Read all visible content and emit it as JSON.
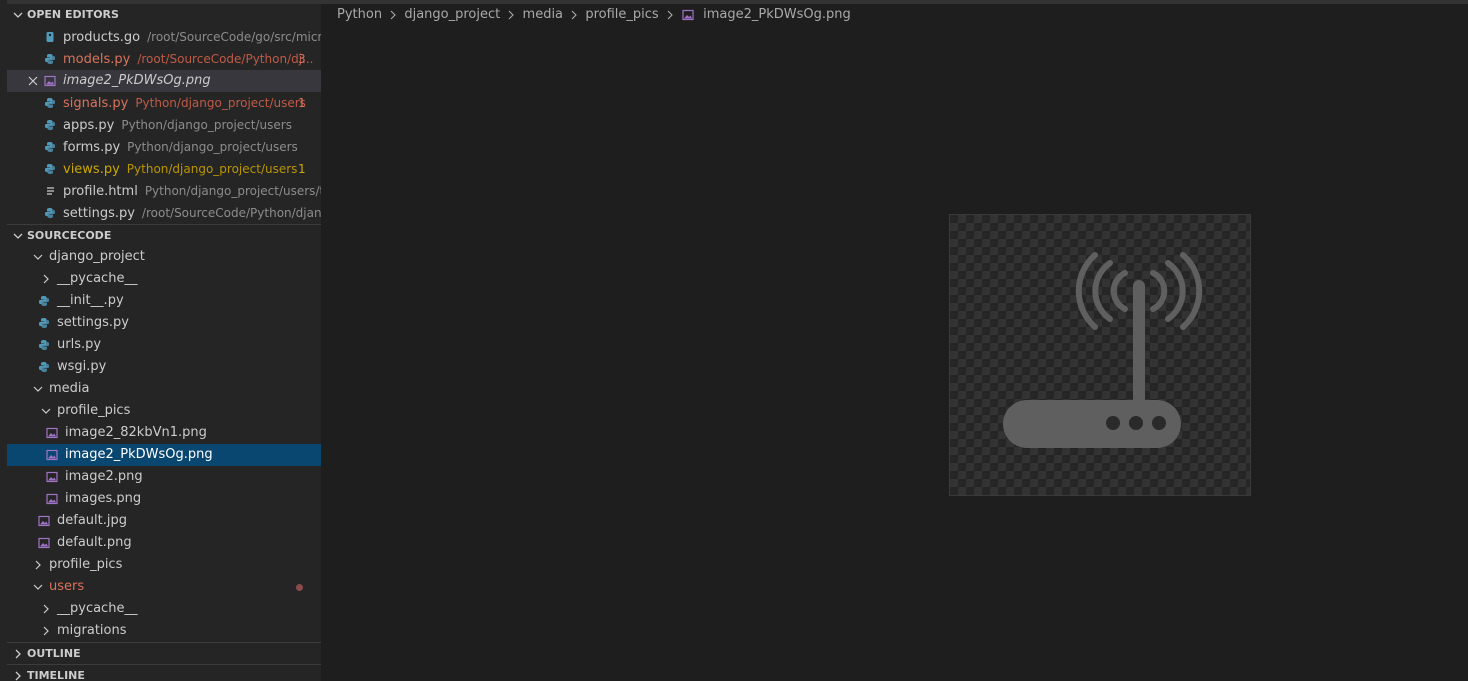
{
  "colors": {
    "sidebar_bg": "#252526",
    "editor_bg": "#1e1e1e",
    "selection": "#094771",
    "modified": "#d9735b",
    "warning": "#cca700",
    "python_icon": "#519aba",
    "image_icon": "#a074c4"
  },
  "open_editors": {
    "title": "OPEN EDITORS",
    "items": [
      {
        "name": "products.go",
        "path": "/root/SourceCode/go/src/micros...",
        "badge": "",
        "icon": "go-file-icon"
      },
      {
        "name": "models.py",
        "path": "/root/SourceCode/Python/dj...",
        "badge": "3",
        "icon": "python-file-icon"
      },
      {
        "name": "image2_PkDWsOg.png",
        "path": "",
        "badge": "",
        "icon": "image-file-icon"
      },
      {
        "name": "signals.py",
        "path": "Python/django_project/users",
        "badge": "1",
        "icon": "python-file-icon"
      },
      {
        "name": "apps.py",
        "path": "Python/django_project/users",
        "badge": "",
        "icon": "python-file-icon"
      },
      {
        "name": "forms.py",
        "path": "Python/django_project/users",
        "badge": "",
        "icon": "python-file-icon"
      },
      {
        "name": "views.py",
        "path": "Python/django_project/users",
        "badge": "1",
        "icon": "python-file-icon"
      },
      {
        "name": "profile.html",
        "path": "Python/django_project/users/te...",
        "badge": "",
        "icon": "html-file-icon"
      },
      {
        "name": "settings.py",
        "path": "/root/SourceCode/Python/djang...",
        "badge": "",
        "icon": "python-file-icon"
      }
    ]
  },
  "explorer": {
    "title": "SOURCECODE",
    "items": [
      {
        "name": "django_project",
        "type": "folder-open"
      },
      {
        "name": "__pycache__",
        "type": "folder-closed"
      },
      {
        "name": "__init__.py",
        "type": "python"
      },
      {
        "name": "settings.py",
        "type": "python"
      },
      {
        "name": "urls.py",
        "type": "python"
      },
      {
        "name": "wsgi.py",
        "type": "python"
      },
      {
        "name": "media",
        "type": "folder-open"
      },
      {
        "name": "profile_pics",
        "type": "folder-open"
      },
      {
        "name": "image2_82kbVn1.png",
        "type": "image"
      },
      {
        "name": "image2_PkDWsOg.png",
        "type": "image"
      },
      {
        "name": "image2.png",
        "type": "image"
      },
      {
        "name": "images.png",
        "type": "image"
      },
      {
        "name": "default.jpg",
        "type": "image"
      },
      {
        "name": "default.png",
        "type": "image"
      },
      {
        "name": "profile_pics",
        "type": "folder-closed"
      },
      {
        "name": "users",
        "type": "folder-open"
      },
      {
        "name": "__pycache__",
        "type": "folder-closed"
      },
      {
        "name": "migrations",
        "type": "folder-closed"
      }
    ]
  },
  "outline": {
    "title": "OUTLINE"
  },
  "timeline": {
    "title": "TIMELINE"
  },
  "breadcrumb": {
    "items": [
      "Python",
      "django_project",
      "media",
      "profile_pics"
    ],
    "file": "image2_PkDWsOg.png"
  },
  "preview": {
    "image_subject": "wifi-router-icon"
  }
}
